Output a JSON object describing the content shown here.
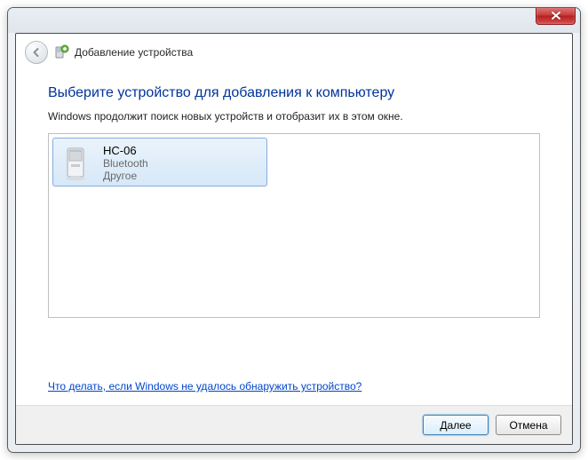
{
  "window": {
    "title": "Добавление устройства"
  },
  "page": {
    "heading": "Выберите устройство для добавления к компьютеру",
    "subtext": "Windows продолжит поиск новых устройств и отобразит их в этом окне."
  },
  "devices": [
    {
      "name": "HC-06",
      "type": "Bluetooth",
      "category": "Другое"
    }
  ],
  "help": {
    "link_text": "Что делать, если Windows не удалось обнаружить устройство?"
  },
  "buttons": {
    "next": "Далее",
    "cancel": "Отмена"
  }
}
